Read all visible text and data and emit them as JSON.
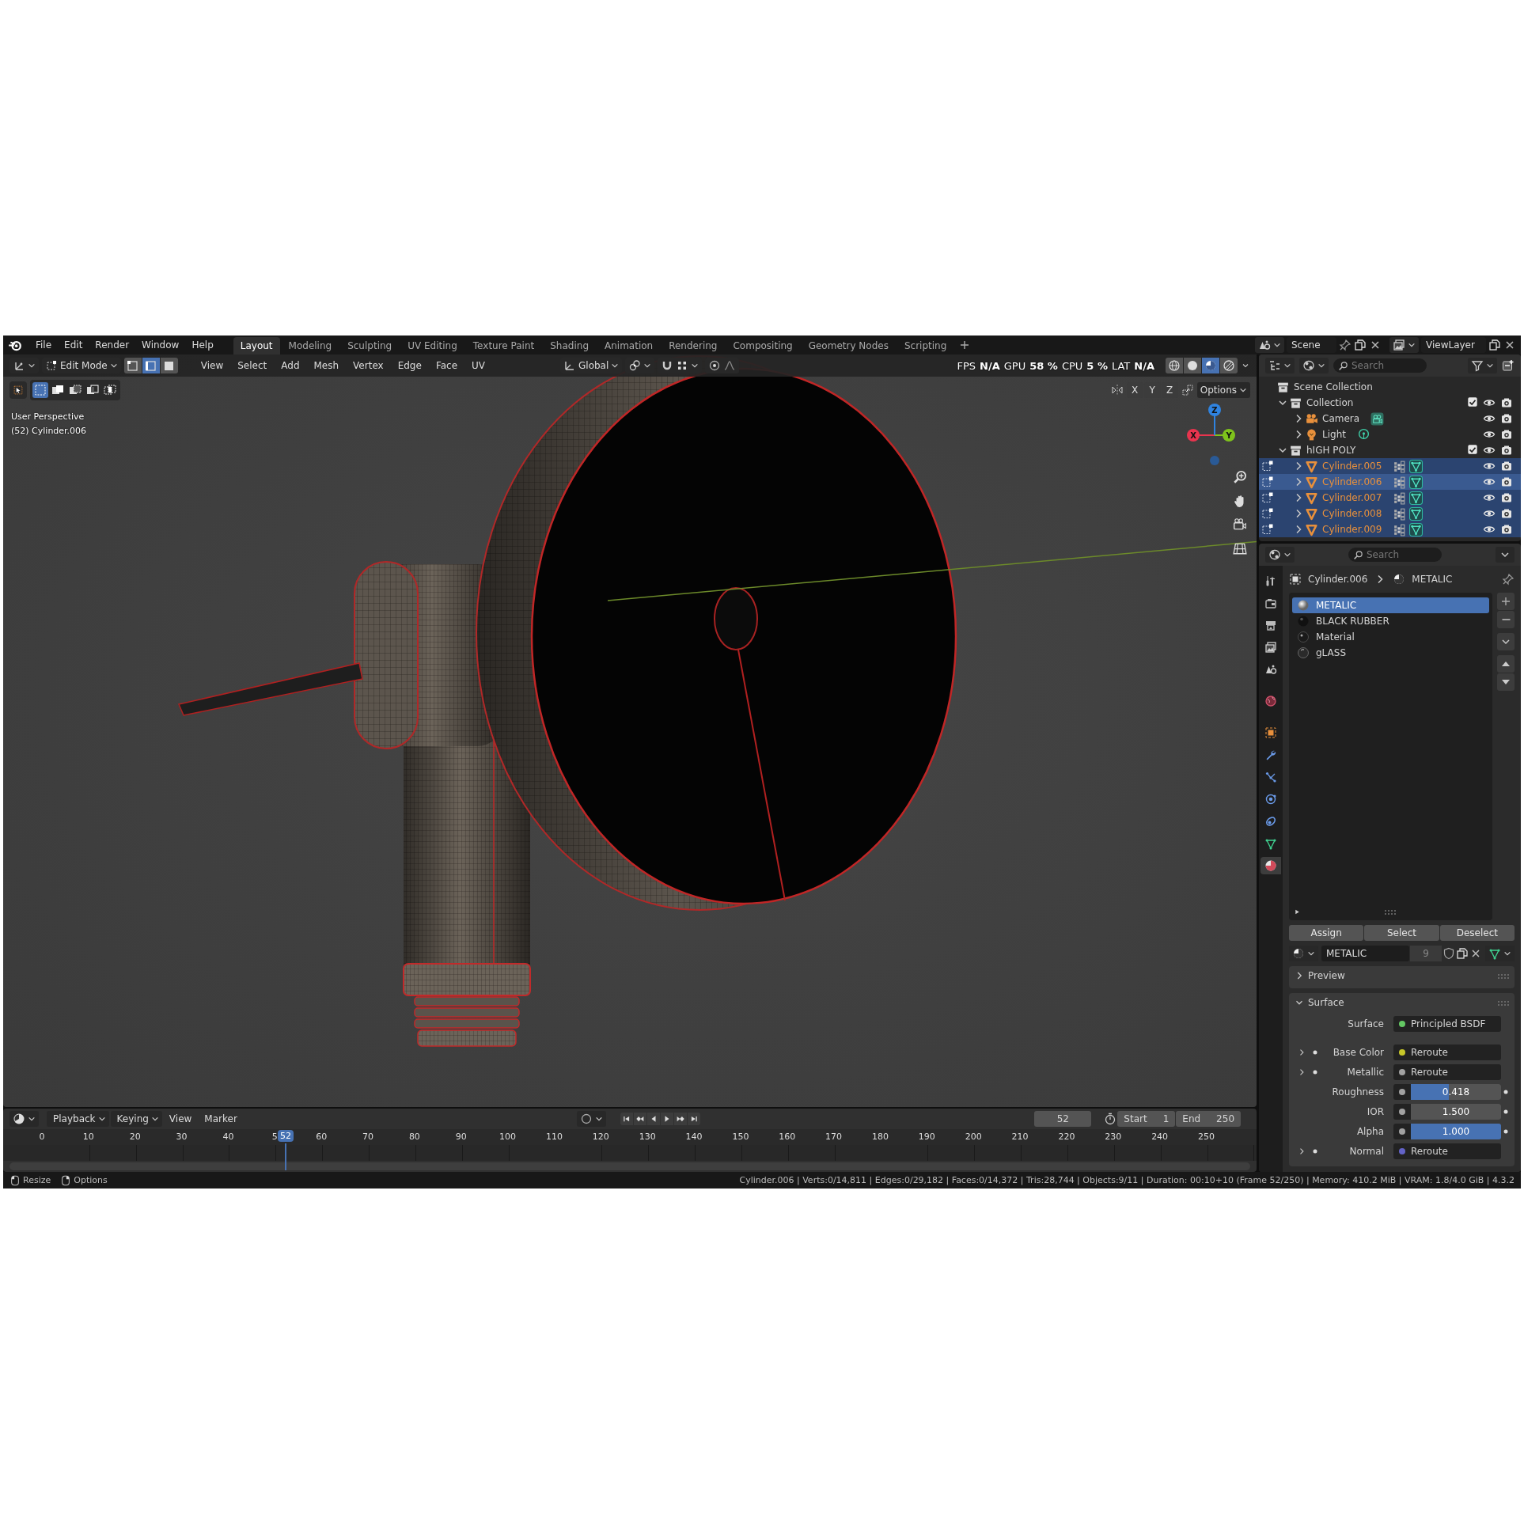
{
  "topbar": {
    "menus": [
      "File",
      "Edit",
      "Render",
      "Window",
      "Help"
    ],
    "workspaces": [
      {
        "label": "Layout",
        "selected": true
      },
      {
        "label": "Modeling",
        "selected": false
      },
      {
        "label": "Sculpting",
        "selected": false
      },
      {
        "label": "UV Editing",
        "selected": false
      },
      {
        "label": "Texture Paint",
        "selected": false
      },
      {
        "label": "Shading",
        "selected": false
      },
      {
        "label": "Animation",
        "selected": false
      },
      {
        "label": "Rendering",
        "selected": false
      },
      {
        "label": "Compositing",
        "selected": false
      },
      {
        "label": "Geometry Nodes",
        "selected": false
      },
      {
        "label": "Scripting",
        "selected": false
      }
    ],
    "scene": "Scene",
    "view_layer": "ViewLayer"
  },
  "viewport": {
    "mode": "Edit Mode",
    "select_modes": [
      {
        "kind": "vertex",
        "selected": false
      },
      {
        "kind": "edge",
        "selected": true
      },
      {
        "kind": "face",
        "selected": false
      }
    ],
    "menus": [
      "View",
      "Select",
      "Add",
      "Mesh",
      "Vertex",
      "Edge",
      "Face",
      "UV"
    ],
    "orientation": "Global",
    "stats": [
      "FPS",
      "N/A",
      "GPU",
      "58 %",
      "CPU",
      "5 %",
      "LAT",
      "N/A"
    ],
    "shading": [
      {
        "kind": "wireframe",
        "selected": false
      },
      {
        "kind": "solid",
        "selected": false
      },
      {
        "kind": "material",
        "selected": true
      },
      {
        "kind": "rendered",
        "selected": false
      }
    ],
    "box_modes": [
      {
        "kind": "set",
        "selected": true
      },
      {
        "kind": "extend",
        "selected": false
      },
      {
        "kind": "subtract",
        "selected": false
      },
      {
        "kind": "invert",
        "selected": false
      },
      {
        "kind": "intersect",
        "selected": false
      }
    ],
    "mirror_axes": [
      "X",
      "Y",
      "Z"
    ],
    "options": "Options",
    "view_name": "User Perspective",
    "object_info": "(52) Cylinder.006",
    "gizmo": [
      {
        "label": "X",
        "color": "#e8344e"
      },
      {
        "label": "Y",
        "color": "#7fc31c"
      },
      {
        "label": "Z",
        "color": "#2f83e0"
      }
    ]
  },
  "outliner": {
    "search_placeholder": "Search",
    "tree": [
      {
        "label": "Scene Collection",
        "kind": "scene_collection",
        "selected": false,
        "children": [
          {
            "label": "Collection",
            "kind": "collection",
            "expanded": true,
            "checked": true,
            "selected": false,
            "children": [
              {
                "label": "Camera",
                "kind": "camera",
                "expanded": false,
                "selected": false,
                "active": false
              },
              {
                "label": "Light",
                "kind": "light",
                "expanded": false,
                "selected": false,
                "active": false
              }
            ]
          },
          {
            "label": "hIGH POLY",
            "kind": "collection",
            "expanded": true,
            "checked": true,
            "selected": false,
            "children": [
              {
                "label": "Cylinder.005",
                "kind": "mesh",
                "expanded": false,
                "selected": true,
                "active": false
              },
              {
                "label": "Cylinder.006",
                "kind": "mesh",
                "expanded": false,
                "selected": true,
                "active": true
              },
              {
                "label": "Cylinder.007",
                "kind": "mesh",
                "expanded": false,
                "selected": true,
                "active": false
              },
              {
                "label": "Cylinder.008",
                "kind": "mesh",
                "expanded": false,
                "selected": true,
                "active": false
              },
              {
                "label": "Cylinder.009",
                "kind": "mesh",
                "expanded": false,
                "selected": true,
                "active": false
              }
            ]
          }
        ]
      }
    ]
  },
  "properties": {
    "search_placeholder": "Search",
    "tabs": [
      {
        "kind": "tool",
        "selected": false
      },
      {
        "kind": "render",
        "selected": false
      },
      {
        "kind": "output",
        "selected": false
      },
      {
        "kind": "view_layer",
        "selected": false
      },
      {
        "kind": "scene",
        "selected": false
      },
      {
        "kind": "world",
        "selected": false
      },
      {
        "kind": "object",
        "selected": false
      },
      {
        "kind": "modifiers",
        "selected": false
      },
      {
        "kind": "particles",
        "selected": false
      },
      {
        "kind": "physics",
        "selected": false
      },
      {
        "kind": "constraints",
        "selected": false
      },
      {
        "kind": "data",
        "selected": false
      },
      {
        "kind": "material",
        "selected": true
      }
    ],
    "breadcrumb": {
      "object": "Cylinder.006",
      "material": "METALIC"
    },
    "material_slots": [
      {
        "label": "METALIC",
        "kind": "metal",
        "selected": true
      },
      {
        "label": "BLACK RUBBER",
        "kind": "rubber",
        "selected": false
      },
      {
        "label": "Material",
        "kind": "dark",
        "selected": false
      },
      {
        "label": "gLASS",
        "kind": "glass",
        "selected": false
      }
    ],
    "slot_actions": [
      "Assign",
      "Select",
      "Deselect"
    ],
    "material": {
      "name": "METALIC",
      "users": "9"
    },
    "panels": [
      {
        "label": "Preview",
        "expanded": false
      },
      {
        "label": "Surface",
        "expanded": true,
        "rows": [
          {
            "label": "Surface",
            "kind": "link",
            "value": "Principled BSDF",
            "color": "#63c763",
            "expandable": false
          },
          {
            "label": "Base Color",
            "kind": "link",
            "value": "Reroute",
            "color": "#c7c729",
            "expandable": true
          },
          {
            "label": "Metallic",
            "kind": "link",
            "value": "Reroute",
            "color": "#a1a1a1",
            "expandable": true
          },
          {
            "label": "Roughness",
            "kind": "slider",
            "value": "0.418",
            "level": 0.418,
            "color": "#a1a1a1",
            "expandable": false
          },
          {
            "label": "IOR",
            "kind": "number",
            "value": "1.500",
            "color": "#a1a1a1",
            "expandable": false
          },
          {
            "label": "Alpha",
            "kind": "slider",
            "value": "1.000",
            "level": 1,
            "color": "#a1a1a1",
            "expandable": false
          },
          {
            "label": "Normal",
            "kind": "link",
            "value": "Reroute",
            "color": "#6363c7",
            "expandable": true
          }
        ]
      }
    ]
  },
  "timeline": {
    "menus": [
      {
        "label": "Playback",
        "kind": "dropdown"
      },
      {
        "label": "Keying",
        "kind": "dropdown"
      },
      {
        "label": "View",
        "kind": "menu"
      },
      {
        "label": "Marker",
        "kind": "menu"
      }
    ],
    "auto_key": false,
    "current_frame": "52",
    "start_label": "Start",
    "start": "1",
    "end_label": "End",
    "end": "250",
    "ruler_labels": [
      "0",
      "10",
      "20",
      "30",
      "40",
      "5",
      "60",
      "70",
      "80",
      "90",
      "100",
      "110",
      "120",
      "130",
      "140",
      "150",
      "160",
      "170",
      "180",
      "190",
      "200",
      "210",
      "220",
      "230",
      "240",
      "250"
    ],
    "playhead": "52"
  },
  "status_bar": {
    "hints": [
      {
        "label": "Resize",
        "kind": "left_mouse"
      },
      {
        "label": "Options",
        "kind": "right_mouse"
      }
    ],
    "stats": "Cylinder.006 | Verts:0/14,811 | Edges:0/29,182 | Faces:0/14,372 | Tris:28,744 | Objects:9/11 | Duration: 00:10+10 (Frame 52/250) | Memory: 410.2 MiB | VRAM: 1.8/4.0 GiB | 4.3.2"
  }
}
